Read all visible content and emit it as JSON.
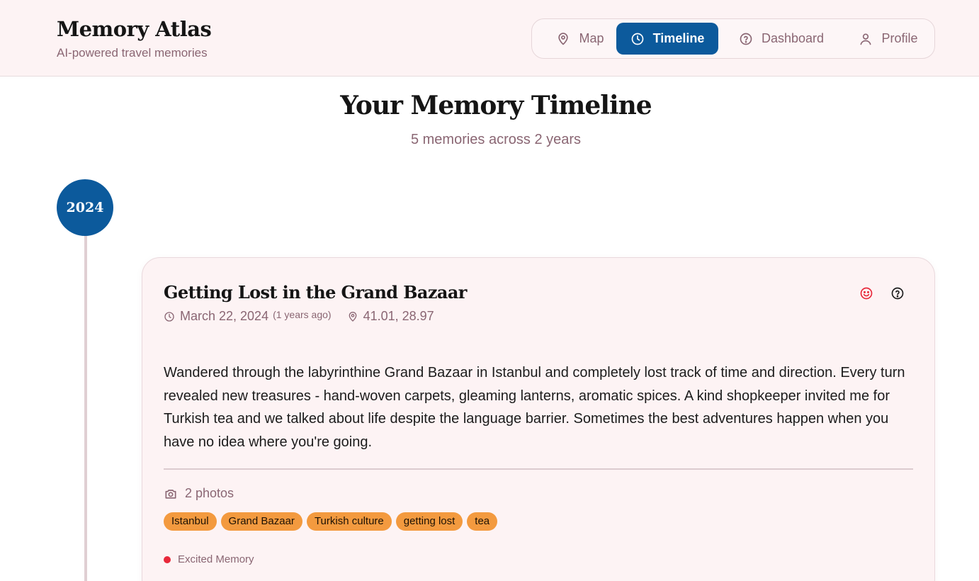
{
  "brand": {
    "title": "Memory Atlas",
    "subtitle": "AI-powered travel memories"
  },
  "nav": {
    "items": [
      {
        "label": "Map",
        "icon": "map-pin-icon"
      },
      {
        "label": "Timeline",
        "icon": "clock-icon",
        "active": true
      },
      {
        "label": "Dashboard",
        "icon": "help-circle-icon"
      },
      {
        "label": "Profile",
        "icon": "user-icon"
      }
    ]
  },
  "page": {
    "title": "Your Memory Timeline",
    "subtitle": "5 memories across 2 years"
  },
  "timeline": {
    "year": "2024"
  },
  "memory": {
    "title": "Getting Lost in the Grand Bazaar",
    "date": "March 22, 2024",
    "ago": "(1 years ago)",
    "coords": "41.01, 28.97",
    "body": "Wandered through the labyrinthine Grand Bazaar in Istanbul and completely lost track of time and direction. Every turn revealed new treasures - hand-woven carpets, gleaming lanterns, aromatic spices. A kind shopkeeper invited me for Turkish tea and we talked about life despite the language barrier. Sometimes the best adventures happen when you have no idea where you're going.",
    "photos": "2 photos",
    "tags": [
      "Istanbul",
      "Grand Bazaar",
      "Turkish culture",
      "getting lost",
      "tea"
    ],
    "mood": "Excited Memory"
  },
  "colors": {
    "primary": "#0c5a9c",
    "accent_tag": "#f39a3f",
    "muted_text": "#8a6673",
    "mood_dot": "#e8283a",
    "header_bg": "#fdf3f4"
  }
}
